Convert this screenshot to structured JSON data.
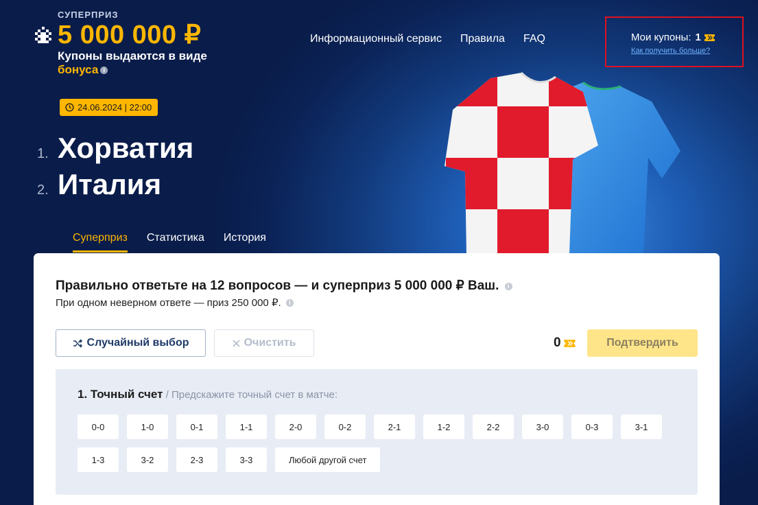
{
  "header": {
    "prize_label": "СУПЕРПРИЗ",
    "prize_amount": "5 000 000 ₽",
    "note_line1": "Купоны выдаются в виде",
    "note_bonus": "бонуса",
    "nav": [
      "Информационный сервис",
      "Правила",
      "FAQ"
    ]
  },
  "coupons": {
    "title": "Мои купоны:",
    "count": "1",
    "link": "Как получить больше?"
  },
  "match": {
    "datetime": "24.06.2024 | 22:00",
    "teams": [
      {
        "num": "1.",
        "name": "Хорватия"
      },
      {
        "num": "2.",
        "name": "Италия"
      }
    ]
  },
  "tabs": [
    "Суперприз",
    "Статистика",
    "История"
  ],
  "card": {
    "title": "Правильно ответьте на 12 вопросов — и суперприз 5 000 000 ₽ Ваш.",
    "subtitle": "При одном неверном ответе — приз 250 000 ₽.",
    "random_label": "Случайный выбор",
    "clear_label": "Очистить",
    "coupon_count": "0",
    "confirm_label": "Подтвердить"
  },
  "question": {
    "title": "1. Точный счет",
    "hint": " / Предскажите точный счет в матче:",
    "options": [
      "0-0",
      "1-0",
      "0-1",
      "1-1",
      "2-0",
      "0-2",
      "2-1",
      "1-2",
      "2-2",
      "3-0",
      "0-3",
      "3-1",
      "1-3",
      "3-2",
      "2-3",
      "3-3",
      "Любой другой счет"
    ]
  },
  "colors": {
    "accent": "#ffb600",
    "background": "#0a1d4a",
    "highlight_border": "#e0101f"
  }
}
